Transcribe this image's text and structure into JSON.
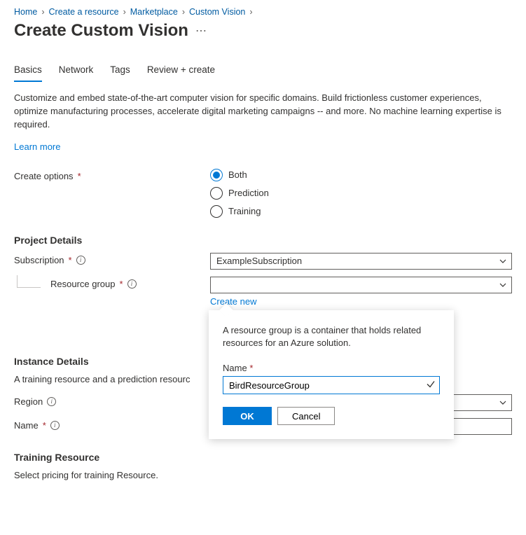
{
  "breadcrumb": {
    "items": [
      {
        "label": "Home"
      },
      {
        "label": "Create a resource"
      },
      {
        "label": "Marketplace"
      },
      {
        "label": "Custom Vision"
      }
    ]
  },
  "header": {
    "title": "Create Custom Vision"
  },
  "tabs": {
    "items": [
      {
        "label": "Basics",
        "active": true
      },
      {
        "label": "Network"
      },
      {
        "label": "Tags"
      },
      {
        "label": "Review + create"
      }
    ]
  },
  "intro": {
    "text": "Customize and embed state-of-the-art computer vision for specific domains. Build frictionless customer experiences, optimize manufacturing processes, accelerate digital marketing campaigns -- and more. No machine learning expertise is required.",
    "learn_more": "Learn more"
  },
  "create_options": {
    "label": "Create options",
    "options": {
      "both": "Both",
      "prediction": "Prediction",
      "training": "Training"
    }
  },
  "project_details": {
    "title": "Project Details",
    "subscription": {
      "label": "Subscription",
      "value": "ExampleSubscription"
    },
    "resource_group": {
      "label": "Resource group",
      "value": "",
      "create_new": "Create new"
    }
  },
  "popup": {
    "description": "A resource group is a container that holds related resources for an Azure solution.",
    "name_label": "Name",
    "name_value": "BirdResourceGroup",
    "ok": "OK",
    "cancel": "Cancel"
  },
  "instance_details": {
    "title": "Instance Details",
    "subtitle": "A training resource and a prediction resourc",
    "region": {
      "label": "Region",
      "value": ""
    },
    "name": {
      "label": "Name",
      "value": ""
    }
  },
  "training_resource": {
    "title": "Training Resource",
    "subtitle": "Select pricing for training Resource."
  }
}
